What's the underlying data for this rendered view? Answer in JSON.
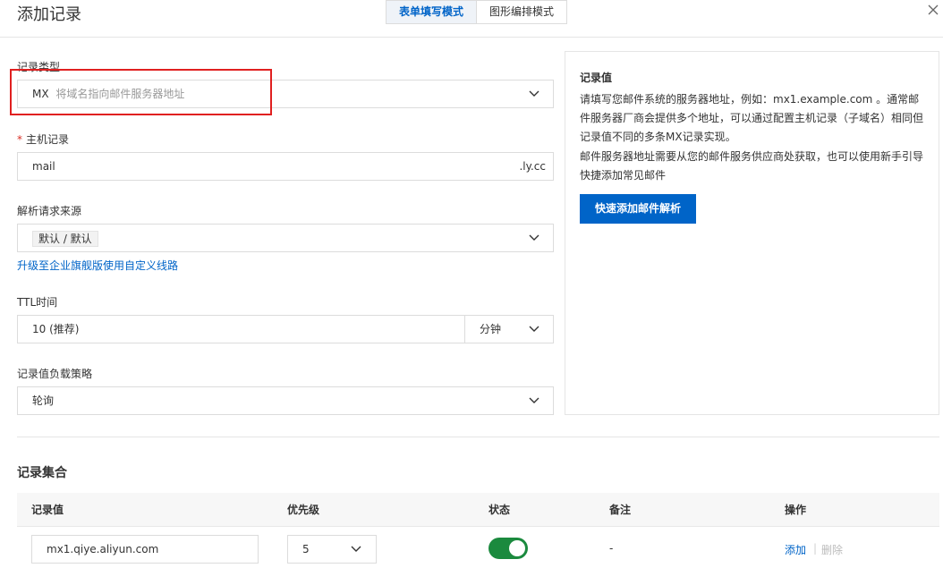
{
  "dialog": {
    "title": "添加记录",
    "mode_tabs": [
      {
        "label": "表单填写模式",
        "active": true
      },
      {
        "label": "图形编排模式",
        "active": false
      }
    ]
  },
  "form": {
    "record_type": {
      "label": "记录类型",
      "value": "MX",
      "hint": "将域名指向邮件服务器地址"
    },
    "host": {
      "label": "主机记录",
      "required_mark": "*",
      "value": "mail",
      "suffix": ".ly.cc"
    },
    "source": {
      "label": "解析请求来源",
      "value": "默认 / 默认",
      "upgrade_link": "升级至企业旗舰版使用自定义线路"
    },
    "ttl": {
      "label": "TTL时间",
      "value": "10 (推荐)",
      "unit": "分钟"
    },
    "strategy": {
      "label": "记录值负载策略",
      "value": "轮询"
    }
  },
  "info": {
    "title": "记录值",
    "p1": "请填写您邮件系统的服务器地址，例如：mx1.example.com 。通常邮件服务器厂商会提供多个地址，可以通过配置主机记录（子域名）相同但记录值不同的多条MX记录实现。",
    "p2": "邮件服务器地址需要从您的邮件服务供应商处获取，也可以使用新手引导快捷添加常见邮件",
    "button": "快速添加邮件解析"
  },
  "records": {
    "title": "记录集合",
    "columns": [
      "记录值",
      "优先级",
      "状态",
      "备注",
      "操作"
    ],
    "rows": [
      {
        "value": "mx1.qiye.aliyun.com",
        "priority": "5",
        "enabled": true,
        "remark": "-",
        "add": "添加",
        "delete": "删除"
      }
    ]
  },
  "colors": {
    "accent": "#0064c8",
    "toggle_on": "#1b8a3e",
    "highlight": "#e02020"
  }
}
